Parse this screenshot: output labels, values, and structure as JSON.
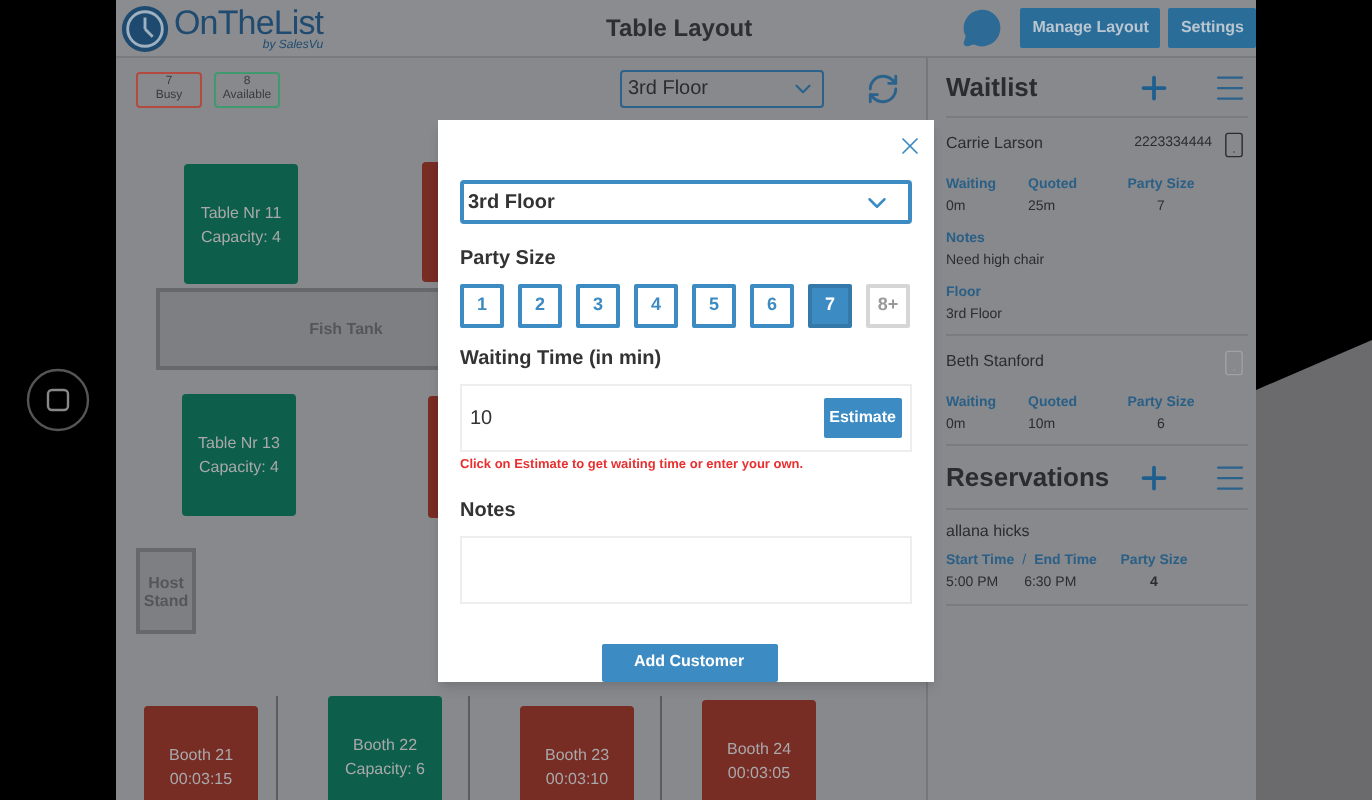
{
  "header": {
    "logo": {
      "name": "OnTheList",
      "tagline": "by SalesVu"
    },
    "title": "Table Layout",
    "buttons": [
      "Manage Layout",
      "Settings"
    ]
  },
  "toolbar": {
    "counters": [
      {
        "count": "7",
        "label": "Busy",
        "color": "#b34a40"
      },
      {
        "count": "8",
        "label": "Available",
        "color": "#3f9a6e"
      }
    ],
    "floor": "3rd Floor"
  },
  "floor_plan": {
    "items": [
      {
        "kind": "table",
        "color": "#0d5e4a",
        "name": "Table Nr 11",
        "detail": "Capacity: 4"
      },
      {
        "kind": "table",
        "color": "#772c24"
      },
      {
        "kind": "fixture",
        "name": "Fish Tank"
      },
      {
        "kind": "table",
        "color": "#0d5e4a",
        "name": "Table Nr 13",
        "detail": "Capacity: 4"
      },
      {
        "kind": "table",
        "color": "#772c24"
      },
      {
        "kind": "stand",
        "name": "Host Stand"
      },
      {
        "kind": "table",
        "color": "#772c24",
        "name": "Booth 21",
        "detail": "00:03:15"
      },
      {
        "kind": "table",
        "color": "#0d5e4a",
        "name": "Booth 22",
        "detail": "Capacity: 6"
      },
      {
        "kind": "table",
        "color": "#772c24",
        "name": "Booth 23",
        "detail": "00:03:10"
      },
      {
        "kind": "table",
        "color": "#772c24",
        "name": "Booth 24",
        "detail": "00:03:05"
      }
    ]
  },
  "modal": {
    "floor": "3rd Floor",
    "party_size_label": "Party Size",
    "party_sizes": [
      {
        "label": "1",
        "selected": false,
        "disabled": false
      },
      {
        "label": "2",
        "selected": false,
        "disabled": false
      },
      {
        "label": "3",
        "selected": false,
        "disabled": false
      },
      {
        "label": "4",
        "selected": false,
        "disabled": false
      },
      {
        "label": "5",
        "selected": false,
        "disabled": false
      },
      {
        "label": "6",
        "selected": false,
        "disabled": false
      },
      {
        "label": "7",
        "selected": true,
        "disabled": false
      },
      {
        "label": "8+",
        "selected": false,
        "disabled": true
      }
    ],
    "waiting_label": "Waiting Time (in min)",
    "waiting_value": "10",
    "estimate_button": "Estimate",
    "hint": "Click on Estimate to get waiting time or enter your own.",
    "notes_label": "Notes",
    "submit": "Add Customer"
  },
  "waitlist": {
    "title": "Waitlist",
    "entries": [
      {
        "name": "Carrie Larson",
        "phone": "2223334444",
        "phone_active": true,
        "fields": [
          {
            "label": "Waiting",
            "value": "0m"
          },
          {
            "label": "Quoted",
            "value": "25m"
          },
          {
            "label": "Party Size",
            "value": "7"
          }
        ],
        "extras": [
          {
            "label": "Notes",
            "value": "Need high chair"
          },
          {
            "label": "Floor",
            "value": "3rd Floor"
          }
        ]
      },
      {
        "name": "Beth Stanford",
        "phone_active": false,
        "fields": [
          {
            "label": "Waiting",
            "value": "0m"
          },
          {
            "label": "Quoted",
            "value": "10m"
          },
          {
            "label": "Party Size",
            "value": "6"
          }
        ]
      }
    ]
  },
  "reservations": {
    "title": "Reservations",
    "entries": [
      {
        "name": "allana hicks",
        "start_label": "Start Time",
        "separator": "/",
        "end_label": "End Time",
        "party_label": "Party Size",
        "start": "5:00 PM",
        "end": "6:30 PM",
        "party": "4"
      }
    ]
  }
}
